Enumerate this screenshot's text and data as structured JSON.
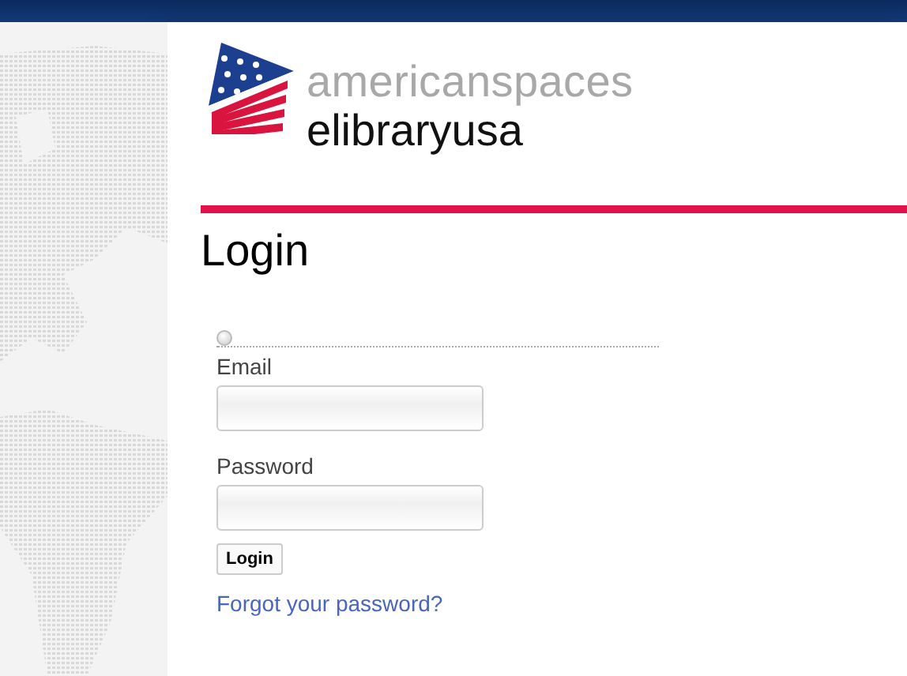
{
  "logo": {
    "line_1": "americanspaces",
    "line_2": "elibraryusa"
  },
  "heading": "Login",
  "slider": {
    "level": 0
  },
  "form": {
    "fields": [
      {
        "label": "Email"
      },
      {
        "label": "Password"
      }
    ],
    "submit": "Login",
    "forgot_link": "Forgot your password?"
  }
}
